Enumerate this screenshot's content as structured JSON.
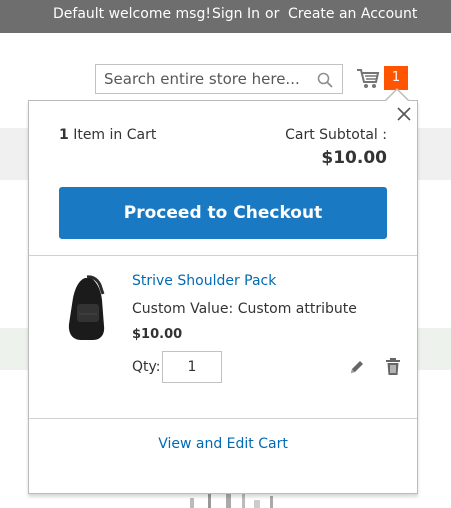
{
  "header": {
    "welcome": "Default welcome msg!",
    "sign_in": "Sign In",
    "or": "or",
    "create_account": "Create an Account"
  },
  "search": {
    "placeholder": "Search entire store here...",
    "icon": "search-icon"
  },
  "cart": {
    "icon": "cart-icon",
    "count": "1"
  },
  "minicart": {
    "items_count": "1",
    "items_label": " Item in Cart",
    "subtotal_label": "Cart Subtotal :",
    "subtotal_value": "$10.00",
    "checkout_label": "Proceed to Checkout",
    "item": {
      "name": "Strive Shoulder Pack",
      "option": "Custom Value: Custom attribute",
      "price": "$10.00",
      "qty_label": "Qty:",
      "qty": "1"
    },
    "view_cart_label": "View and Edit Cart"
  },
  "colors": {
    "accent": "#1979c3",
    "badge": "#ff5501",
    "link": "#006bb4",
    "topbar": "#6e6e6e"
  }
}
